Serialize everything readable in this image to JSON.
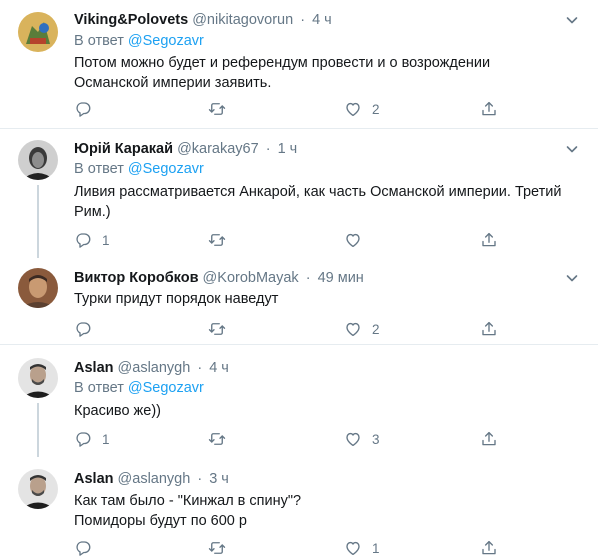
{
  "tweets": [
    {
      "name": "Viking&Polovets",
      "handle": "@nikitagovorun",
      "time": "4 ч",
      "reply_prefix": "В ответ",
      "reply_to": "@Segozavr",
      "text": "Потом можно будет и референдум провести и о возрождении Османской империи заявить.",
      "replies": "",
      "retweets": "",
      "likes": "2"
    },
    {
      "name": "Юрій Каракай",
      "handle": "@karakay67",
      "time": "1 ч",
      "reply_prefix": "В ответ",
      "reply_to": "@Segozavr",
      "text": "Ливия рассматривается Анкарой, как часть Османской империи. Третий Рим.)",
      "replies": "1",
      "retweets": "",
      "likes": ""
    },
    {
      "name": "Виктор Коробков",
      "handle": "@KorobMayak",
      "time": "49 мин",
      "text": "Турки придут порядок наведут",
      "replies": "",
      "retweets": "",
      "likes": "2"
    },
    {
      "name": "Aslan",
      "handle": "@aslanygh",
      "time": "4 ч",
      "reply_prefix": "В ответ",
      "reply_to": "@Segozavr",
      "text": "Красиво же))",
      "replies": "1",
      "retweets": "",
      "likes": "3"
    },
    {
      "name": "Aslan",
      "handle": "@aslanygh",
      "time": "3 ч",
      "text": "Как там было - \"Кинжал в спину\"? Помидоры будут по 600 р",
      "replies": "",
      "retweets": "",
      "likes": "1"
    }
  ],
  "colors": {
    "accent": "#1da1f2",
    "secondary_text": "#657786",
    "divider": "#e6ecf0",
    "thread": "#ccd6dd"
  },
  "icons": [
    "reply-icon",
    "retweet-icon",
    "like-icon",
    "share-icon",
    "chevron-down-icon"
  ]
}
